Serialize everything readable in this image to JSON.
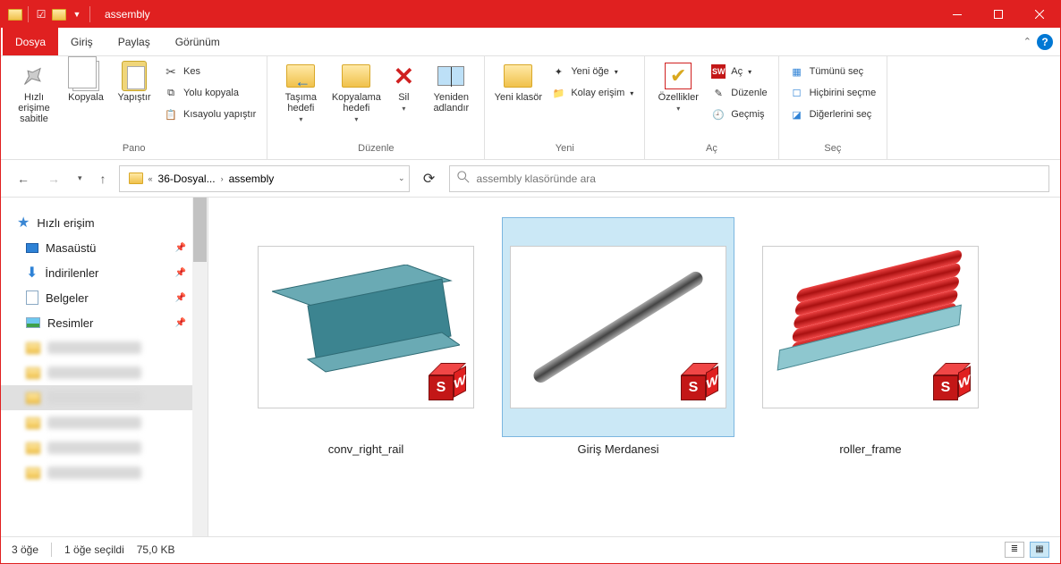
{
  "window": {
    "title": "assembly"
  },
  "tabs": {
    "file": "Dosya",
    "home": "Giriş",
    "share": "Paylaş",
    "view": "Görünüm"
  },
  "ribbon": {
    "clipboard": {
      "pin": "Hızlı erişime sabitle",
      "copy": "Kopyala",
      "paste": "Yapıştır",
      "cut": "Kes",
      "copy_path": "Yolu kopyala",
      "paste_shortcut": "Kısayolu yapıştır",
      "label": "Pano"
    },
    "organize": {
      "move": "Taşıma hedefi",
      "copy_to": "Kopyalama hedefi",
      "delete": "Sil",
      "rename": "Yeniden adlandır",
      "label": "Düzenle"
    },
    "new": {
      "folder": "Yeni klasör",
      "new_item": "Yeni öğe",
      "easy_access": "Kolay erişim",
      "label": "Yeni"
    },
    "open": {
      "properties": "Özellikler",
      "open": "Aç",
      "edit": "Düzenle",
      "history": "Geçmiş",
      "label": "Aç"
    },
    "select": {
      "all": "Tümünü seç",
      "none": "Hiçbirini seçme",
      "invert": "Diğerlerini seç",
      "label": "Seç"
    }
  },
  "breadcrumb": {
    "seg1": "36-Dosyal...",
    "seg2": "assembly"
  },
  "search": {
    "placeholder": "assembly klasöründe ara"
  },
  "nav": {
    "quick": "Hızlı erişim",
    "desktop": "Masaüstü",
    "downloads": "İndirilenler",
    "documents": "Belgeler",
    "pictures": "Resimler"
  },
  "files": {
    "f1": "conv_right_rail",
    "f2": "Giriş Merdanesi",
    "f3": "roller_frame"
  },
  "status": {
    "count": "3 öğe",
    "selected": "1 öğe seçildi",
    "size": "75,0 KB"
  }
}
